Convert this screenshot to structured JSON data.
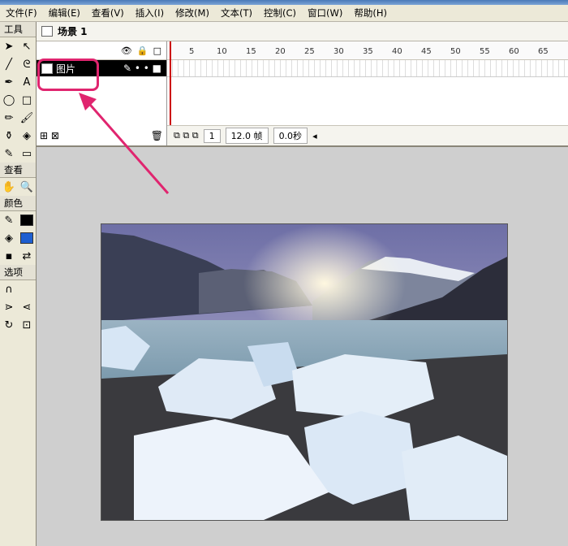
{
  "menu": [
    "文件(F)",
    "编辑(E)",
    "查看(V)",
    "插入(I)",
    "修改(M)",
    "文本(T)",
    "控制(C)",
    "窗口(W)",
    "帮助(H)"
  ],
  "toolbox": {
    "title": "工具",
    "view_label": "查看",
    "color_label": "颜色",
    "options_label": "选项",
    "tools_icons": [
      "arrow-icon",
      "subselect-icon",
      "line-icon",
      "lasso-icon",
      "pen-icon",
      "text-icon",
      "oval-icon",
      "rect-icon",
      "pencil-icon",
      "brush-icon",
      "ink-bottle-icon",
      "paint-bucket-icon",
      "eyedropper-icon",
      "eraser-icon"
    ],
    "stroke_color": "#000000",
    "fill_color": "#1e5fd0"
  },
  "timeline": {
    "scene": "场景 1",
    "layer_name": "图片",
    "ruler": [
      "5",
      "10",
      "15",
      "20",
      "25",
      "30",
      "35",
      "40",
      "45",
      "50",
      "55",
      "60",
      "65"
    ],
    "current_frame": "1",
    "frame_rate": "12.0 帧",
    "elapsed": "0.0秒"
  },
  "colors": {
    "highlight": "#e0256f"
  }
}
